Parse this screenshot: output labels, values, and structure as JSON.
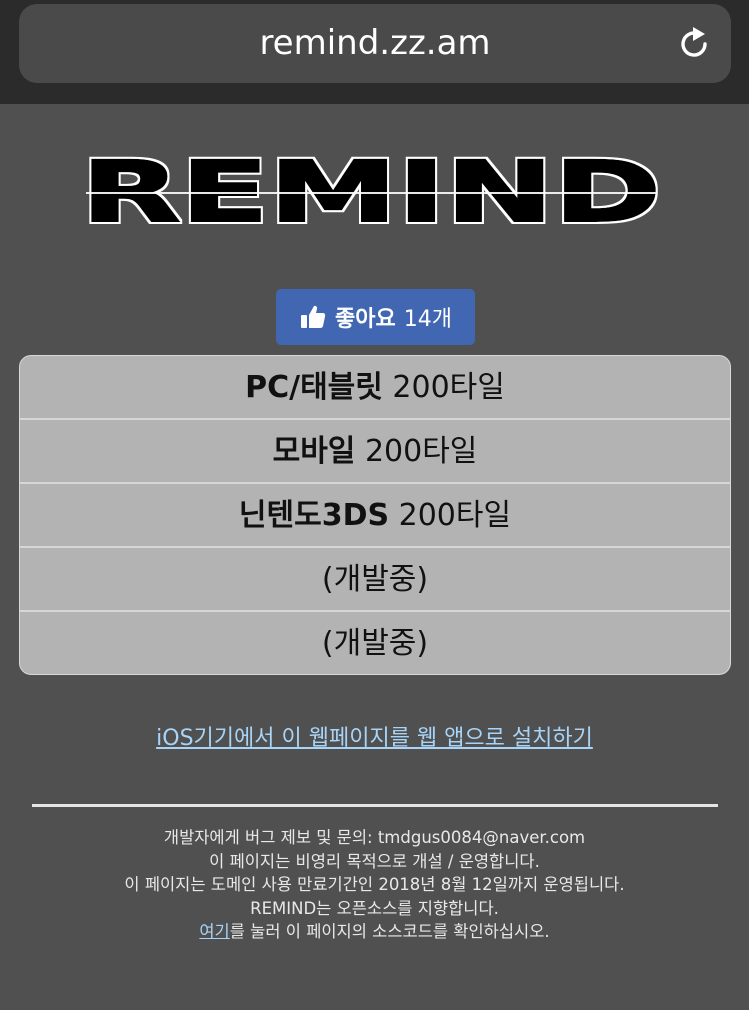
{
  "browser": {
    "url": "remind.zz.am",
    "reload_icon": "reload-icon"
  },
  "logo": {
    "text": "REMIND"
  },
  "like_button": {
    "icon": "thumbs-up-icon",
    "label": "좋아요",
    "count": "14개",
    "color": "#4267b2"
  },
  "menu": {
    "items": [
      {
        "bold": "PC/태블릿",
        "rest": " 200타일"
      },
      {
        "bold": "모바일",
        "rest": " 200타일"
      },
      {
        "bold": "닌텐도3DS",
        "rest": " 200타일"
      },
      {
        "bold": "",
        "rest": "(개발중)"
      },
      {
        "bold": "",
        "rest": "(개발중)"
      }
    ]
  },
  "ios_link": "iOS기기에서 이 웹페이지를 웹 앱으로 설치하기",
  "footer": {
    "line1": "개발자에게 버그 제보 및 문의: tmdgus0084@naver.com",
    "line2": "이 페이지는 비영리 목적으로 개설 / 운영합니다.",
    "line3": "이 페이지는 도메인 사용 만료기간인 2018년 8월 12일까지 운영됩니다.",
    "line4": "REMIND는 오픈소스를 지향합니다.",
    "line5_link": "여기",
    "line5_rest": "를 눌러 이 페이지의 소스코드를 확인하십시오."
  },
  "colors": {
    "background": "#505050",
    "topbar": "#2b2b2b",
    "link": "#a8d4f7"
  }
}
